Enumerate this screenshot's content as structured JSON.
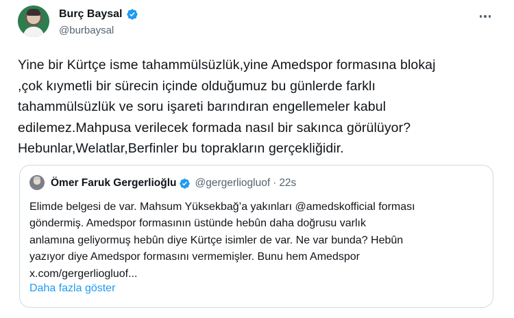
{
  "author": {
    "display_name": "Burç Baysal",
    "handle": "@burbaysal",
    "verified": true,
    "avatar_icon": "profile-photo"
  },
  "more_icon": "more-horizontal-icon",
  "tweet": {
    "lines": [
      "Yine bir Kürtçe isme tahammülsüzlük,yine Amedspor formasına blokaj",
      ",çok kıymetli bir sürecin içinde olduğumuz bu günlerde farklı",
      "tahammülsüzlük ve soru işareti barındıran engellemeler kabul",
      "edilemez.Mahpusa verilecek formada nasıl bir sakınca görülüyor?",
      "Hebunlar,Welatlar,Berfinler bu toprakların gerçekliğidir."
    ]
  },
  "quote": {
    "display_name": "Ömer Faruk Gergerlioğlu",
    "handle": "@gergerliogluof",
    "separator": "·",
    "time": "22s",
    "verified": true,
    "lines": [
      "Elimde belgesi de var. Mahsum Yüksekbağ’a yakınları @amedskofficial  forması",
      "göndermiş. Amedspor formasının üstünde hebûn daha doğrusu varlık",
      "anlamına geliyormuş hebûn diye Kürtçe isimler de var. Ne var bunda? Hebûn",
      "yazıyor diye Amedspor formasını vermemişler. Bunu hem Amedspor",
      "x.com/gergerliogluof..."
    ],
    "show_more": "Daha fazla göster"
  },
  "colors": {
    "text": "#0f1419",
    "secondary": "#536471",
    "link": "#1d9bf0",
    "verified": "#1d9bf0",
    "border": "#cfd9de"
  }
}
